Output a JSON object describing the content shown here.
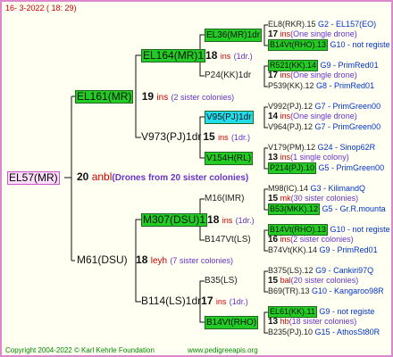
{
  "header": "16-  3-2022 ( 18: 29)",
  "root": {
    "name": "EL57(MR)",
    "num": "20",
    "ins": "anbl",
    "note": "(Drones from 20 sister colonies)"
  },
  "g1": [
    {
      "name": "EL161(MR)",
      "num": "19",
      "ins": "ins",
      "note": "(2 sister colonies)"
    },
    {
      "name": "M61(DSU)",
      "num": "18",
      "ins": "leyh",
      "note": "(7 sister colonies)"
    }
  ],
  "g2": [
    {
      "name": "EL164(MR)1",
      "num": "18",
      "ins": "ins",
      "note": "(1dr.)"
    },
    {
      "name": "V973(PJ)1dr",
      "num": "15",
      "ins": "ins",
      "note": "(1dr.)"
    },
    {
      "name": "M307(DSU)1",
      "num": "18",
      "ins": "ins",
      "note": "(1dr.)"
    },
    {
      "name": "B114(LS)1dr",
      "num": "17",
      "ins": "ins",
      "note": "(1dr.)"
    }
  ],
  "g3": [
    {
      "name": "EL36(MR)1dr",
      "num": "17",
      "ins": "ins",
      "note": "(One single drone)"
    },
    {
      "name": "P24(KK)1dr",
      "num": "17",
      "ins": "ins",
      "note": "(One single drone)"
    },
    {
      "name": "V95(PJ)1dr",
      "num": "14",
      "ins": "ins",
      "note": "(One single drone)"
    },
    {
      "name": "V154H(RL)",
      "num": "13",
      "ins": "ins",
      "note": "(1 single colony)"
    },
    {
      "name": "M16(IMR)",
      "num": "15",
      "ins": "mk",
      "note": "(30 sister colonies)"
    },
    {
      "name": "B147Vt(LS)",
      "num": "16",
      "ins": "ins",
      "note": "(2 sister colonies)"
    },
    {
      "name": "B35(LS)",
      "num": "15",
      "ins": "bal",
      "note": "(20 sister colonies)"
    },
    {
      "name": "B14Vt(RHO)",
      "num": "13",
      "ins": "hb",
      "note": "(18 sister colonies)"
    }
  ],
  "g4": [
    {
      "name": "EL8(RKR).15",
      "ref": "G2 - EL157(EO)"
    },
    {
      "name": "B14Vt(RHO).13",
      "ref": "G10 - not registe"
    },
    {
      "name": "R521(KK).14",
      "ref": "G9 - PrimRed01"
    },
    {
      "name": "P539(KK).12",
      "ref": "G8 - PrimRed01"
    },
    {
      "name": "V992(PJ).12",
      "ref": "G7 - PrimGreen00"
    },
    {
      "name": "V964(PJ).12",
      "ref": "G7 - PrimGreen00"
    },
    {
      "name": "V179(PM).12",
      "ref": "G24 - Sinop62R"
    },
    {
      "name": "P214(PJ).10",
      "ref": "G5 - PrimGreen00"
    },
    {
      "name": "M98(IC).14",
      "ref": "G3 - KilimandQ"
    },
    {
      "name": "B53(MKK).12",
      "ref": "G5 - Gr.R.mounta"
    },
    {
      "name": "B14Vt(RHO).13",
      "ref": "G10 - not registe"
    },
    {
      "name": "B74Vt(KK).14",
      "ref": "G9 - PrimRed01"
    },
    {
      "name": "B375(LS).12",
      "ref": "G9 - Cankiri97Q"
    },
    {
      "name": "B69(TR).13",
      "ref": "G10 - Kangaroo98R"
    },
    {
      "name": "EL61(KK).11",
      "ref": "G9 - not registe"
    },
    {
      "name": "B235(PJ).10",
      "ref": "G15 - AthosSt80R"
    }
  ],
  "footer": {
    "copyright": "Copyright 2004-2022 © Karl Kehrle Foundation",
    "site": "www.pedigreeapis.org"
  }
}
